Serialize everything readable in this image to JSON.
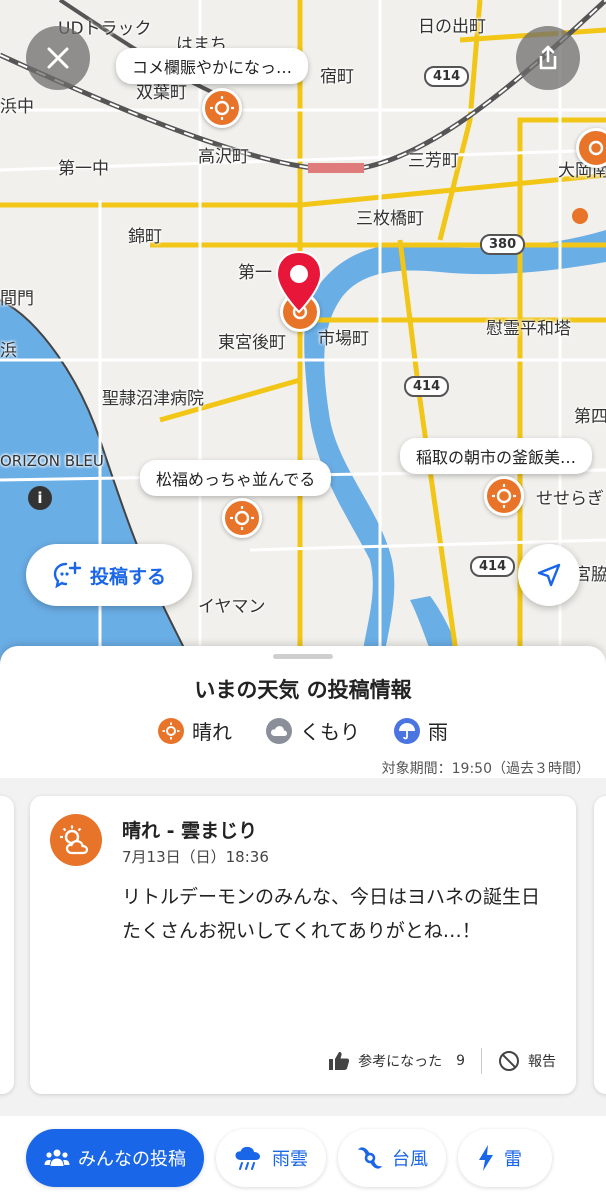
{
  "map": {
    "places": [
      "UDトラック",
      "はまち",
      "宿町",
      "日の出町",
      "双葉町",
      "浜中",
      "高沢町",
      "第一中",
      "三芳町",
      "大岡南",
      "三枚橋町",
      "錦町",
      "第一",
      "間門",
      "東宮後町",
      "市場町",
      "慰霊平和塔",
      "浜",
      "聖隷沼津病院",
      "第四",
      "ORIZON BLEU",
      "せせらぎ",
      "宮脇",
      "イヤマン"
    ],
    "road_numbers": [
      "414",
      "380",
      "414",
      "414"
    ],
    "bubbles": [
      "コメ欄賑やかになっ…",
      "松福めっちゃ並んでる",
      "稲取の朝市の釜飯美…"
    ],
    "post_button_label": "投稿する"
  },
  "sheet": {
    "title": "いまの天気 の投稿情報",
    "legend": [
      {
        "label": "晴れ",
        "icon": "sun-icon",
        "color": "#e8742a"
      },
      {
        "label": "くもり",
        "icon": "cloud-icon",
        "color": "#8a8f99"
      },
      {
        "label": "雨",
        "icon": "umbrella-icon",
        "color": "#4a74e0"
      }
    ],
    "period": "対象期間：19:50（過去３時間）",
    "card": {
      "title": "晴れ - 雲まじり",
      "date": "7月13日（日）18:36",
      "body": "リトルデーモンのみんな、今日はヨハネの誕生日たくさんお祝いしてくれてありがとね…！",
      "helpful_label": "参考になった",
      "helpful_count": "9",
      "report_label": "報告"
    }
  },
  "bottom_nav": [
    {
      "label": "みんなの投稿",
      "icon": "people-icon",
      "active": true
    },
    {
      "label": "雨雲",
      "icon": "rain-cloud-icon",
      "active": false
    },
    {
      "label": "台風",
      "icon": "typhoon-icon",
      "active": false
    },
    {
      "label": "雷",
      "icon": "lightning-icon",
      "active": false
    }
  ],
  "colors": {
    "accent": "#1a66e8",
    "sun": "#e8742a",
    "pin": "#e8173a",
    "water": "#6aaee6"
  }
}
